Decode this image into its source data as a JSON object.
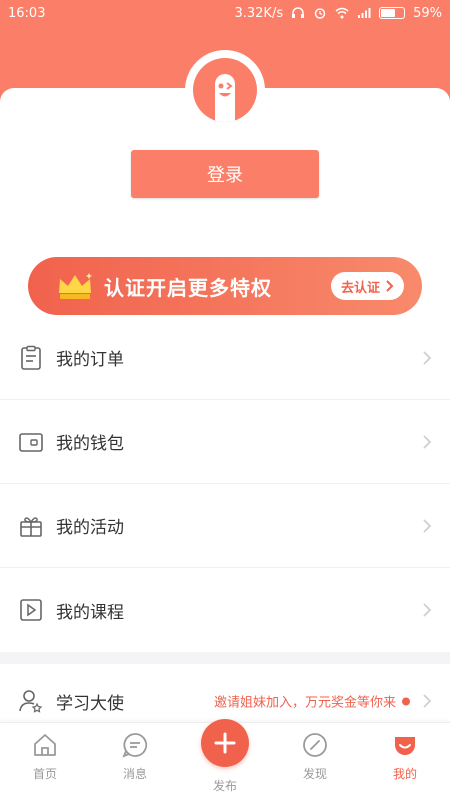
{
  "status_bar": {
    "time": "16:03",
    "network_speed": "3.32K/s",
    "battery_percent": "59%"
  },
  "profile": {
    "login_label": "登录"
  },
  "banner": {
    "title": "认证开启更多特权",
    "button_label": "去认证"
  },
  "menu": {
    "items": [
      {
        "label": "我的订单"
      },
      {
        "label": "我的钱包"
      },
      {
        "label": "我的活动"
      },
      {
        "label": "我的课程"
      }
    ],
    "ambassador": {
      "label": "学习大使",
      "promo_text": "邀请姐妹加入，万元奖金等你来"
    }
  },
  "tabbar": {
    "items": [
      {
        "label": "首页"
      },
      {
        "label": "消息"
      },
      {
        "label": "发布"
      },
      {
        "label": "发现"
      },
      {
        "label": "我的"
      }
    ],
    "active_index": 4
  },
  "colors": {
    "brand": "#fb7f68",
    "accent": "#f1624d",
    "text": "#333333",
    "muted": "#9a9a9a"
  },
  "icons": {
    "menu": [
      "clipboard-icon",
      "wallet-icon",
      "gift-icon",
      "video-icon"
    ],
    "ambassador": "user-star-icon",
    "tabbar": [
      "home-icon",
      "message-icon",
      "plus-icon",
      "compass-icon",
      "smiley-icon"
    ]
  }
}
